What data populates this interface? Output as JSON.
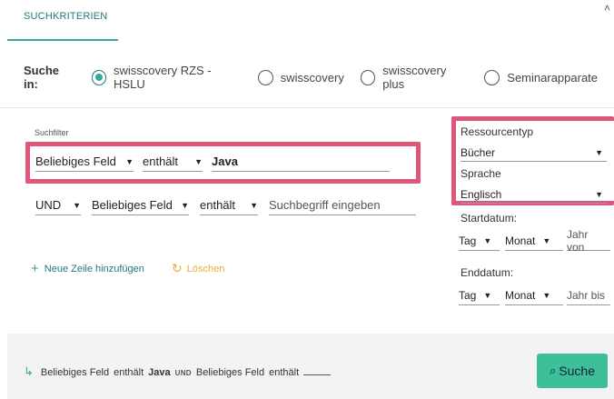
{
  "tab": {
    "label": "SUCHKRITERIEN"
  },
  "collapse_icon": "chevron-up-icon",
  "search_in": {
    "label": "Suche in:",
    "options": [
      "swisscovery RZS - HSLU",
      "swisscovery",
      "swisscovery plus",
      "Seminarapparate"
    ],
    "selected": "swisscovery RZS - HSLU"
  },
  "filter": {
    "label": "Suchfilter",
    "row1": {
      "field": "Beliebiges Feld",
      "operator": "enthält",
      "value": "Java"
    },
    "row2": {
      "bool": "UND",
      "field": "Beliebiges Feld",
      "operator": "enthält",
      "placeholder": "Suchbegriff eingeben"
    },
    "add_row": "Neue Zeile hinzufügen",
    "reset": "Löschen"
  },
  "side": {
    "resource_type_label": "Ressourcentyp",
    "resource_type_value": "Bücher",
    "language_label": "Sprache",
    "language_value": "Englisch",
    "start_label": "Startdatum:",
    "end_label": "Enddatum:",
    "day": "Tag",
    "month": "Monat",
    "year_from": "Jahr von",
    "year_to": "Jahr bis"
  },
  "summary": {
    "field1": "Beliebiges Feld",
    "op1": "enthält",
    "value1": "Java",
    "bool": "UND",
    "field2": "Beliebiges Feld",
    "op2": "enthält"
  },
  "search_button": "Suche",
  "colors": {
    "accent": "#3aa6a0",
    "highlight": "#e0567a",
    "button": "#3dbf9a",
    "reset": "#f2a93b"
  }
}
